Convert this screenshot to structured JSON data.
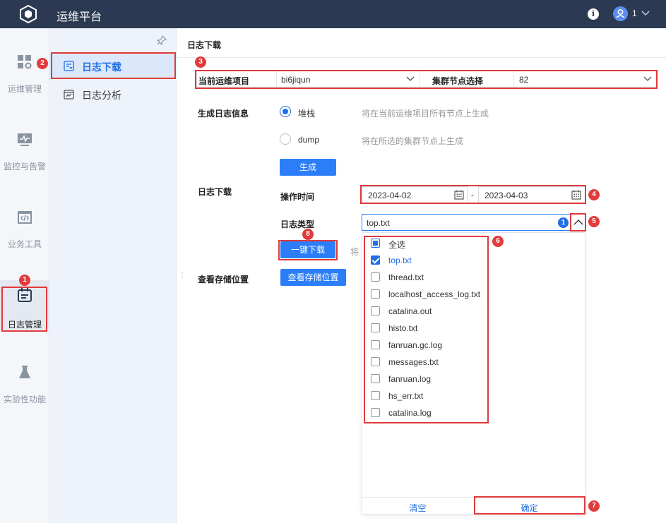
{
  "app": {
    "title": "运维平台",
    "user_name": "1"
  },
  "leftnav": {
    "items": [
      {
        "label": "运维管理",
        "icon": "grid-gear-icon"
      },
      {
        "label": "监控与告警",
        "icon": "monitor-icon"
      },
      {
        "label": "业务工具",
        "icon": "code-window-icon"
      },
      {
        "label": "日志管理",
        "icon": "calendar-icon",
        "active": true
      },
      {
        "label": "实验性功能",
        "icon": "flask-icon"
      }
    ]
  },
  "subnav": {
    "items": [
      {
        "label": "日志下载",
        "icon": "download-list-icon",
        "active": true
      },
      {
        "label": "日志分析",
        "icon": "chart-calendar-icon"
      }
    ]
  },
  "main": {
    "title": "日志下载",
    "project_label": "当前运维项目",
    "project_value": "bi6jiqun",
    "node_label": "集群节点选择",
    "node_value": "82",
    "gen_info_label": "生成日志信息",
    "radio_stack_label": "堆栈",
    "radio_stack_hint": "将在当前运维项目所有节点上生成",
    "radio_dump_label": "dump",
    "radio_dump_hint": "将在所选的集群节点上生成",
    "generate_button": "生成",
    "download_section_label": "日志下载",
    "op_time_label": "操作时间",
    "date_start": "2023-04-02",
    "date_sep": "-",
    "date_end": "2023-04-03",
    "log_type_label": "日志类型",
    "log_type_value": "top.txt",
    "log_type_count": "1",
    "one_click_download": "一键下载",
    "download_hint_partial": "将",
    "storage_label": "查看存储位置",
    "storage_button": "查看存储位置"
  },
  "dropdown": {
    "select_all": "全选",
    "options": [
      {
        "label": "top.txt",
        "checked": true
      },
      {
        "label": "thread.txt",
        "checked": false
      },
      {
        "label": "localhost_access_log.txt",
        "checked": false
      },
      {
        "label": "catalina.out",
        "checked": false
      },
      {
        "label": "histo.txt",
        "checked": false
      },
      {
        "label": "fanruan.gc.log",
        "checked": false
      },
      {
        "label": "messages.txt",
        "checked": false
      },
      {
        "label": "fanruan.log",
        "checked": false
      },
      {
        "label": "hs_err.txt",
        "checked": false
      },
      {
        "label": "catalina.log",
        "checked": false
      }
    ],
    "clear_button": "清空",
    "confirm_button": "确定"
  },
  "annotations": [
    "1",
    "2",
    "3",
    "4",
    "5",
    "6",
    "7",
    "8"
  ],
  "colors": {
    "accent": "#1f6fe5",
    "topbar": "#2b3a52",
    "annotation": "#e03a3a"
  }
}
